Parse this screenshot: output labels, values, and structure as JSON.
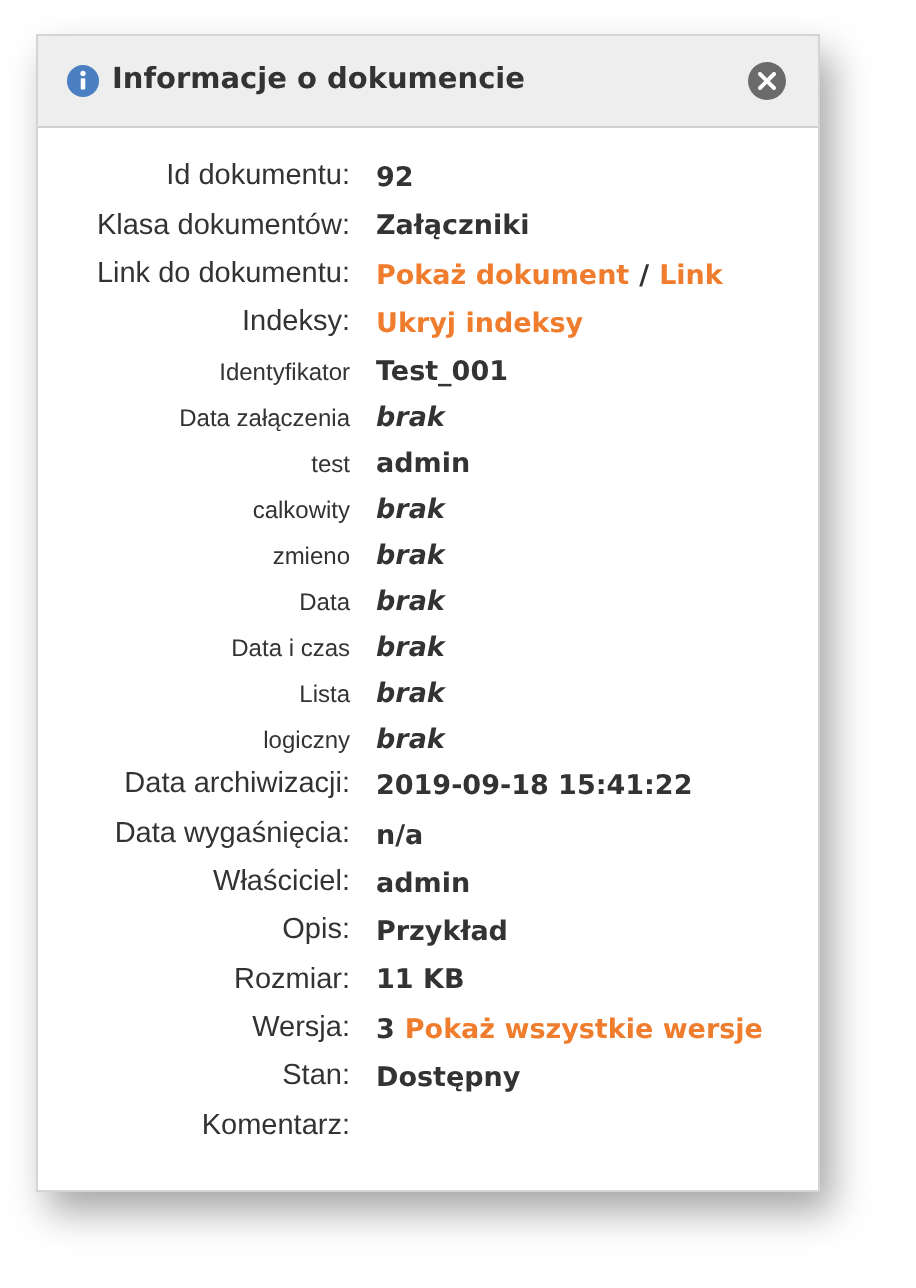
{
  "dialog": {
    "title": "Informacje o dokumencie"
  },
  "fields": [
    {
      "label": "Id dokumentu:",
      "kind": "main",
      "value": [
        {
          "text": "92",
          "kind": "plain"
        }
      ]
    },
    {
      "label": "Klasa dokumentów:",
      "kind": "main",
      "value": [
        {
          "text": "Załączniki",
          "kind": "plain"
        }
      ]
    },
    {
      "label": "Link do dokumentu:",
      "kind": "main",
      "value": [
        {
          "text": "Pokaż dokument",
          "kind": "link"
        },
        {
          "text": "/",
          "kind": "plain"
        },
        {
          "text": "Link",
          "kind": "link"
        }
      ]
    },
    {
      "label": "Indeksy:",
      "kind": "main",
      "value": [
        {
          "text": "Ukryj indeksy",
          "kind": "link"
        }
      ]
    },
    {
      "label": "Identyfikator",
      "kind": "index",
      "value": [
        {
          "text": "Test_001",
          "kind": "plain"
        }
      ]
    },
    {
      "label": "Data załączenia",
      "kind": "index",
      "value": [
        {
          "text": "brak",
          "kind": "empty"
        }
      ]
    },
    {
      "label": "test",
      "kind": "index",
      "value": [
        {
          "text": "admin",
          "kind": "plain"
        }
      ]
    },
    {
      "label": "calkowity",
      "kind": "index",
      "value": [
        {
          "text": "brak",
          "kind": "empty"
        }
      ]
    },
    {
      "label": "zmieno",
      "kind": "index",
      "value": [
        {
          "text": "brak",
          "kind": "empty"
        }
      ]
    },
    {
      "label": "Data",
      "kind": "index",
      "value": [
        {
          "text": "brak",
          "kind": "empty"
        }
      ]
    },
    {
      "label": "Data i czas",
      "kind": "index",
      "value": [
        {
          "text": "brak",
          "kind": "empty"
        }
      ]
    },
    {
      "label": "Lista",
      "kind": "index",
      "value": [
        {
          "text": "brak",
          "kind": "empty"
        }
      ]
    },
    {
      "label": "logiczny",
      "kind": "index",
      "value": [
        {
          "text": "brak",
          "kind": "empty"
        }
      ]
    },
    {
      "label": "Data archiwizacji:",
      "kind": "main",
      "value": [
        {
          "text": "2019-09-18 15:41:22",
          "kind": "plain"
        }
      ]
    },
    {
      "label": "Data wygaśnięcia:",
      "kind": "main",
      "value": [
        {
          "text": "n/a",
          "kind": "plain"
        }
      ]
    },
    {
      "label": "Właściciel:",
      "kind": "main",
      "value": [
        {
          "text": "admin",
          "kind": "plain"
        }
      ]
    },
    {
      "label": "Opis:",
      "kind": "main",
      "value": [
        {
          "text": "Przykład",
          "kind": "plain"
        }
      ]
    },
    {
      "label": "Rozmiar:",
      "kind": "main",
      "value": [
        {
          "text": "11 KB",
          "kind": "plain"
        }
      ]
    },
    {
      "label": "Wersja:",
      "kind": "main",
      "value": [
        {
          "text": "3",
          "kind": "plain"
        },
        {
          "text": "Pokaż wszystkie wersje",
          "kind": "link"
        }
      ]
    },
    {
      "label": "Stan:",
      "kind": "main",
      "value": [
        {
          "text": "Dostępny",
          "kind": "plain"
        }
      ]
    },
    {
      "label": "Komentarz:",
      "kind": "main"
    }
  ]
}
